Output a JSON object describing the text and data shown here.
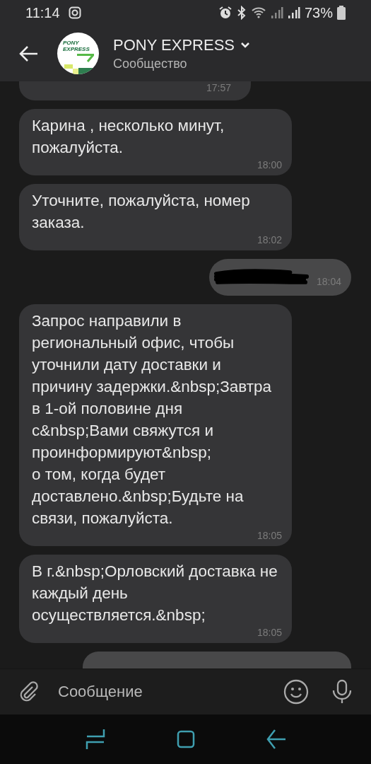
{
  "status_bar": {
    "time": "11:14",
    "battery": "73%"
  },
  "header": {
    "title": "PONY EXPRESS",
    "subtitle": "Сообщество",
    "avatar_logo": "PONY EXPRESS"
  },
  "messages": [
    {
      "kind": "incoming",
      "time": "17:57"
    },
    {
      "kind": "incoming",
      "text": "Карина , несколько минут, пожалуйста.",
      "time": "18:00"
    },
    {
      "kind": "incoming",
      "text": "Уточните, пожалуйста, номер заказа.",
      "time": "18:02"
    },
    {
      "kind": "outgoing",
      "redacted": true,
      "time": "18:04"
    },
    {
      "kind": "incoming",
      "text": "Запрос направили в региональный офис, чтобы уточнили дату доставки и причину задержки.&nbsp;Завтра в 1-ой половине дня с&nbsp;Вами свяжутся и проинформируют&nbsp;\nо том, когда будет доставлено.&nbsp;Будьте на связи, пожалуйста.",
      "time": "18:05"
    },
    {
      "kind": "incoming",
      "text": "В г.&nbsp;Орловский доставка не каждый день осуществляется.&nbsp;",
      "time": "18:05"
    },
    {
      "kind": "outgoing"
    }
  ],
  "composer": {
    "placeholder": "Сообщение"
  }
}
